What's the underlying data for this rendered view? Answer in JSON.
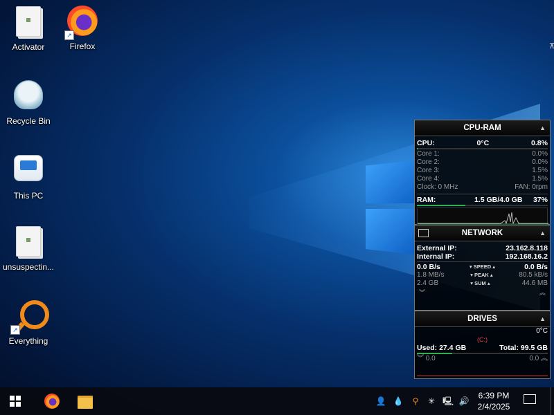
{
  "desktop": {
    "icons": [
      {
        "label": "Activator",
        "icon": "folder-icon"
      },
      {
        "label": "Firefox",
        "icon": "firefox-icon"
      },
      {
        "label": "Recycle Bin",
        "icon": "recycle-bin-icon"
      },
      {
        "label": "This PC",
        "icon": "computer-icon"
      },
      {
        "label": "unsuspectin...",
        "icon": "folder-icon"
      },
      {
        "label": "Everything",
        "icon": "everything-icon"
      }
    ]
  },
  "cpu_ram": {
    "title": "CPU-RAM",
    "cpu_label": "CPU:",
    "cpu_temp": "0°C",
    "cpu_usage": "0.8%",
    "cores": [
      {
        "label": "Core 1:",
        "value": "0.0%"
      },
      {
        "label": "Core 2:",
        "value": "0.0%"
      },
      {
        "label": "Core 3:",
        "value": "1.5%"
      },
      {
        "label": "Core 4:",
        "value": "1.5%"
      }
    ],
    "clock": "Clock: 0 MHz",
    "fan": "FAN: 0rpm",
    "ram_label": "RAM:",
    "ram_amount": "1.5 GB/4.0 GB",
    "ram_percent": "37%",
    "ram_fill": 0.37
  },
  "network": {
    "title": "NETWORK",
    "external_ip_label": "External IP:",
    "external_ip": "23.162.8.118",
    "internal_ip_label": "Internal IP:",
    "internal_ip": "192.168.16.2",
    "speed_left": "0.0 B/s",
    "speed_label": "SPEED",
    "speed_right": "0.0 B/s",
    "peak_left": "1.8 MB/s",
    "peak_label": "PEAK",
    "peak_right": "80.5 kB/s",
    "sum_left": "2.4 GB",
    "sum_label": "SUM",
    "sum_right": "44.6 MB"
  },
  "drives": {
    "title": "DRIVES",
    "temp": "0°C",
    "letter": "(C:)",
    "used": "Used: 27.4 GB",
    "total": "Total: 99.5 GB",
    "read": "0.0",
    "write": "0.0"
  },
  "taskbar": {
    "time": "6:39 PM",
    "date": "2/4/2025"
  }
}
